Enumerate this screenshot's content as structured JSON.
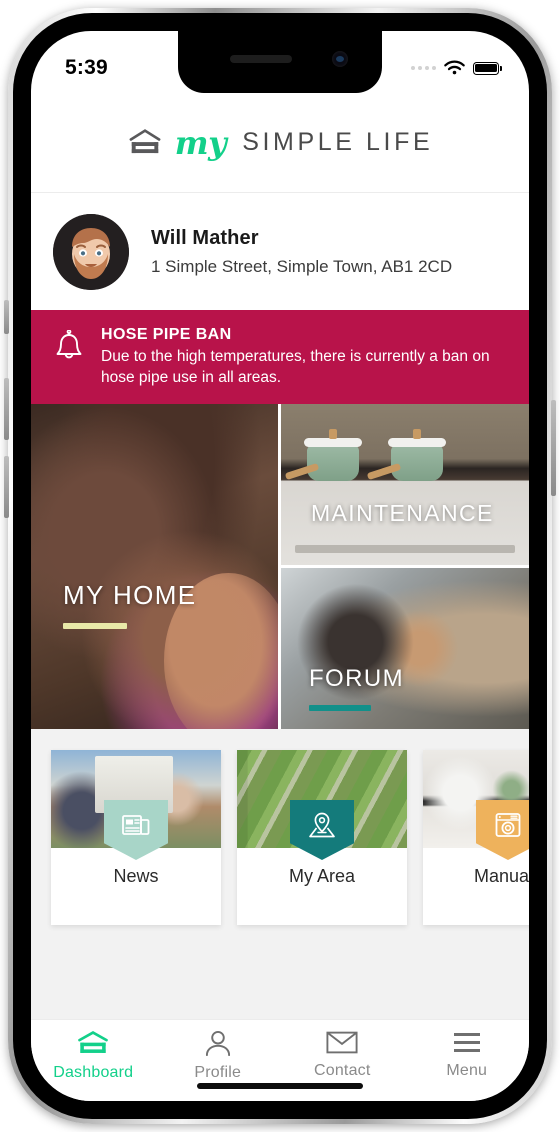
{
  "device": {
    "frame": "iphone",
    "home_indicator": true
  },
  "status_bar": {
    "time": "5:39",
    "signal_icon": "signal-dots-icon",
    "wifi_icon": "wifi-icon",
    "battery_icon": "battery-full-icon"
  },
  "header": {
    "logo_icon": "house-logo-icon",
    "brand_my": "my",
    "brand_rest": "SIMPLE LIFE",
    "accent_color": "#13d08a"
  },
  "profile": {
    "avatar_icon": "user-avatar",
    "name": "Will Mather",
    "address": "1 Simple Street, Simple Town, AB1 2CD"
  },
  "alert": {
    "icon": "bell-icon",
    "title": "HOSE PIPE BAN",
    "message": "Due to the high temperatures, there is currently a ban on hose pipe use in all areas.",
    "background_color": "#b8134a"
  },
  "tiles": [
    {
      "id": "my-home",
      "label": "MY HOME",
      "rule_color": "#e8e9a8",
      "photo": "family-on-sofa"
    },
    {
      "id": "maintenance",
      "label": "MAINTENANCE",
      "rule_color": "",
      "photo": "kitchen-with-green-pots"
    },
    {
      "id": "forum",
      "label": "FORUM",
      "rule_color": "#12908a",
      "photo": "friends-laughing"
    }
  ],
  "cards": [
    {
      "id": "news",
      "label": "News",
      "icon": "newspaper-icon",
      "badge_color": "#a8d5c8",
      "photo": "neighbours-outside-house"
    },
    {
      "id": "my-area",
      "label": "My Area",
      "icon": "map-pin-icon",
      "badge_color": "#147b7b",
      "photo": "aerial-neighbourhood"
    },
    {
      "id": "manuals",
      "label": "Manuals",
      "icon": "washing-machine-icon",
      "badge_color": "#eeb25c",
      "photo": "modern-kitchen"
    }
  ],
  "tabbar": {
    "active": "dashboard",
    "active_color": "#13d08a",
    "inactive_color": "#8a8a8a",
    "items": [
      {
        "id": "dashboard",
        "label": "Dashboard",
        "icon": "house-logo-icon"
      },
      {
        "id": "profile",
        "label": "Profile",
        "icon": "person-icon"
      },
      {
        "id": "contact",
        "label": "Contact",
        "icon": "envelope-icon"
      },
      {
        "id": "menu",
        "label": "Menu",
        "icon": "hamburger-menu-icon"
      }
    ]
  }
}
